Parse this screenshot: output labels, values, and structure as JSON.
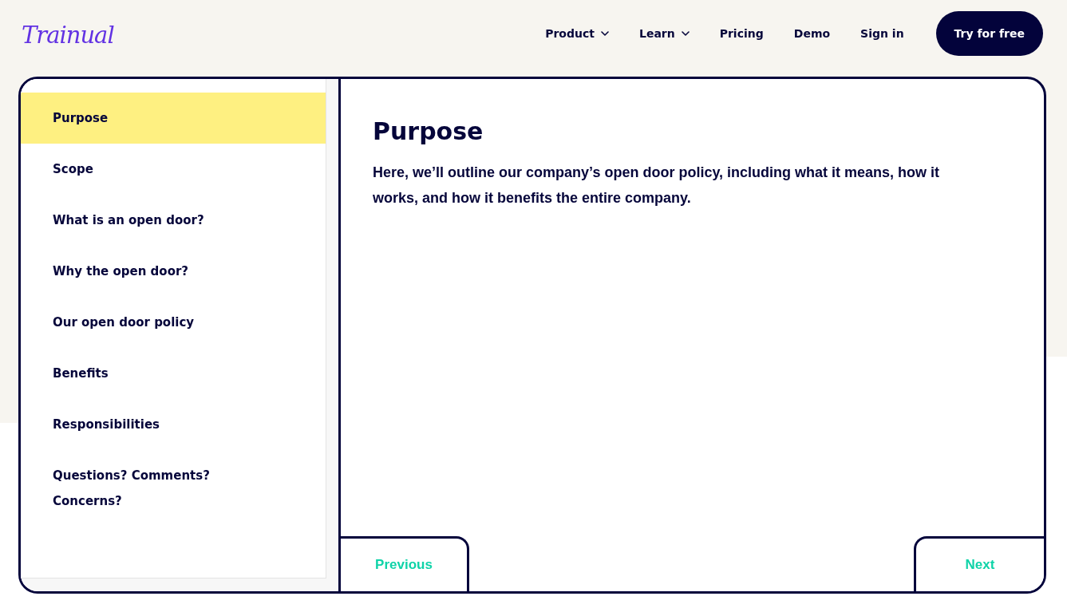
{
  "header": {
    "logo": "Trainual",
    "nav": [
      {
        "label": "Product",
        "kind": "dropdown"
      },
      {
        "label": "Learn",
        "kind": "dropdown"
      },
      {
        "label": "Pricing",
        "kind": "link"
      },
      {
        "label": "Demo",
        "kind": "link"
      },
      {
        "label": "Sign in",
        "kind": "link"
      }
    ],
    "cta": "Try for free"
  },
  "sidebar": {
    "items": [
      {
        "label": "Purpose",
        "selected": true
      },
      {
        "label": "Scope",
        "selected": false
      },
      {
        "label": "What is an open door?",
        "selected": false
      },
      {
        "label": "Why the open door?",
        "selected": false
      },
      {
        "label": "Our open door policy",
        "selected": false
      },
      {
        "label": "Benefits",
        "selected": false
      },
      {
        "label": "Responsibilities",
        "selected": false
      },
      {
        "label": "Questions? Comments? Concerns?",
        "selected": false
      }
    ]
  },
  "content": {
    "title": "Purpose",
    "body": "Here, we’ll outline our company’s open door policy, including what it means, how it works, and how it benefits the entire company."
  },
  "pager": {
    "previous": "Previous",
    "next": "Next"
  }
}
